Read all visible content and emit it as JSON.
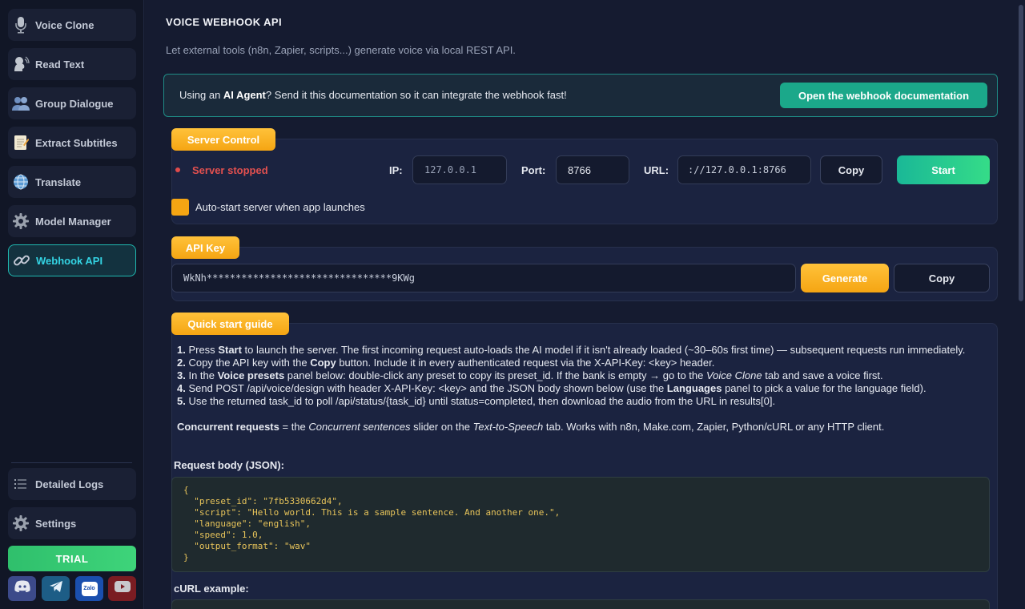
{
  "sidebar": {
    "items": [
      {
        "label": "Voice Clone",
        "icon": "microphone-icon"
      },
      {
        "label": "Read Text",
        "icon": "speaking-head-icon"
      },
      {
        "label": "Group Dialogue",
        "icon": "people-icon"
      },
      {
        "label": "Extract Subtitles",
        "icon": "memo-icon"
      },
      {
        "label": "Translate",
        "icon": "globe-icon"
      },
      {
        "label": "Model Manager",
        "icon": "gear-icon"
      },
      {
        "label": "Webhook API",
        "icon": "link-icon"
      }
    ],
    "active": "Webhook API",
    "bottom": [
      {
        "label": "Detailed Logs",
        "icon": "list-icon"
      },
      {
        "label": "Settings",
        "icon": "gear-icon"
      }
    ],
    "trial_label": "TRIAL",
    "socials": [
      "discord-icon",
      "telegram-icon",
      "zalo-icon",
      "youtube-icon"
    ],
    "zalo_text": "Zalo"
  },
  "page": {
    "title": "VOICE WEBHOOK API",
    "subtitle": "Let external tools (n8n, Zapier, scripts...) generate voice via local REST API."
  },
  "agent_banner": {
    "prefix": "Using an ",
    "bold": "AI Agent",
    "suffix": "? Send it this documentation so it can integrate the webhook fast!",
    "button": "Open the webhook documentation"
  },
  "server": {
    "tag": "Server Control",
    "status": "Server stopped",
    "ip_label": "IP:",
    "ip_value": "127.0.0.1",
    "port_label": "Port:",
    "port_value": "8766",
    "url_label": "URL:",
    "url_value": "://127.0.0.1:8766",
    "copy_label": "Copy",
    "start_label": "Start",
    "autostart_label": "Auto-start server when app launches"
  },
  "api_key": {
    "tag": "API Key",
    "value": "WkNh********************************9KWg",
    "generate_label": "Generate",
    "copy_label": "Copy"
  },
  "guide": {
    "tag": "Quick start guide",
    "step1": {
      "n": "1.",
      "a": " Press ",
      "b": "Start",
      "c": " to launch the server. The first incoming request auto-loads the AI model if it isn't already loaded (~30–60s first time) — subsequent requests run immediately."
    },
    "step2": {
      "n": "2.",
      "a": " Copy the API key with the ",
      "b": "Copy",
      "c": " button. Include it in every authenticated request via the X-API-Key: <key> header."
    },
    "step3": {
      "n": "3.",
      "a": " In the ",
      "b": "Voice presets",
      "c": " panel below: double-click any preset to copy its preset_id. If the bank is empty → go to the ",
      "i": "Voice Clone",
      "d": " tab and save a voice first."
    },
    "step4": {
      "n": "4.",
      "a": " Send POST /api/voice/design with header X-API-Key: <key> and the JSON body shown below (use the ",
      "b": "Languages",
      "c": " panel to pick a value for the language field)."
    },
    "step5": {
      "n": "5.",
      "a": " Use the returned task_id to poll /api/status/{task_id} until status=completed, then download the audio from the URL in results[0]."
    },
    "concurrent": {
      "b": "Concurrent requests",
      "a": " = the ",
      "i1": "Concurrent sentences",
      "c": " slider on the ",
      "i2": "Text-to-Speech",
      "d": " tab. Works with n8n, Make.com, Zapier, Python/cURL or any HTTP client."
    },
    "request_label": "Request body (JSON):",
    "request_body": "{\n  \"preset_id\": \"7fb5330662d4\",\n  \"script\": \"Hello world. This is a sample sentence. And another one.\",\n  \"language\": \"english\",\n  \"speed\": 1.0,\n  \"output_format\": \"wav\"\n}",
    "curl_label": "cURL example:"
  }
}
